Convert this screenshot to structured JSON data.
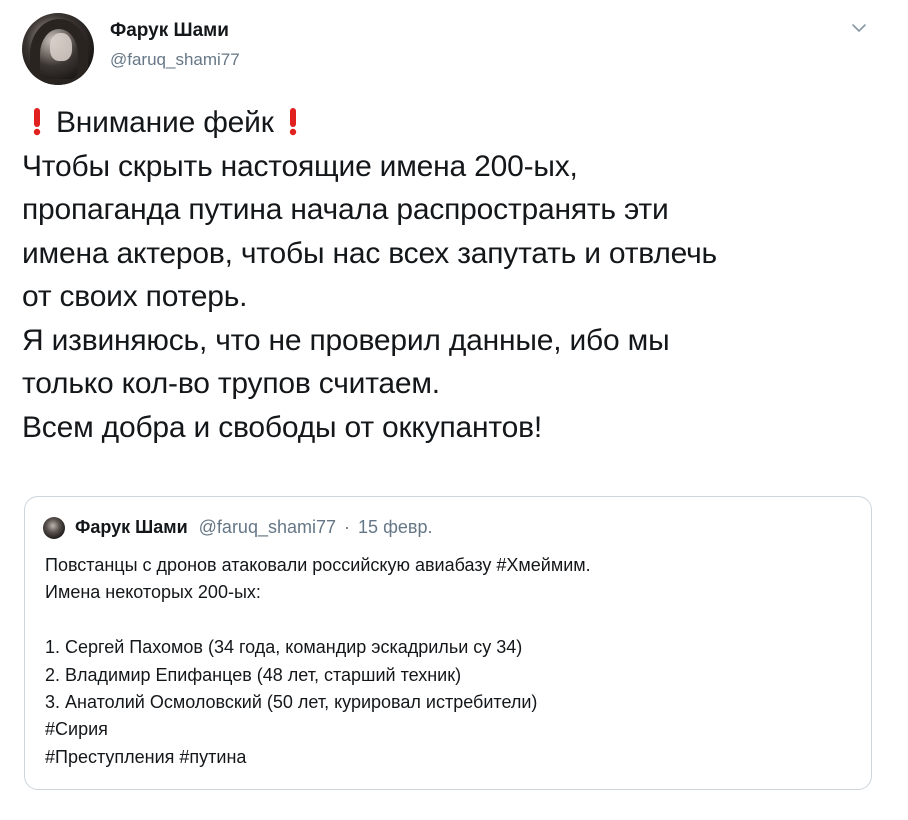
{
  "tweet": {
    "author": {
      "display_name": "Фарук Шами",
      "handle": "@faruq_shami77",
      "avatar_icon": "user-avatar"
    },
    "menu_icon": "chevron-down-icon",
    "alert_icon": "red-exclamation-mark",
    "alert_color": "#e0211f",
    "lines": [
      "Внимание фейк",
      "Чтобы скрыть настоящие имена 200-ых,",
      "пропаганда путина начала распространять эти",
      "имена актеров, чтобы нас всех запутать и отвлечь",
      "от своих потерь.",
      "Я извиняюсь, что не проверил данные, ибо мы",
      "только кол-во трупов считаем.",
      "Всем добра и свободы от оккупантов!"
    ]
  },
  "quoted_tweet": {
    "display_name": "Фарук Шами",
    "handle": "@faruq_shami77",
    "separator": "·",
    "date": "15 февр.",
    "lines": [
      "Повстанцы с дронов атаковали российскую авиабазу #Хмеймим.",
      "Имена некоторых 200-ых:",
      "",
      "1. Сергей Пахомов (34 года, командир эскадрильи су 34)",
      "2. Владимир Епифанцев (48 лет, старший техник)",
      "3. Анатолий Осмоловский (50 лет, курировал истребители)",
      "#Сирия",
      "#Преступления #путина"
    ]
  }
}
